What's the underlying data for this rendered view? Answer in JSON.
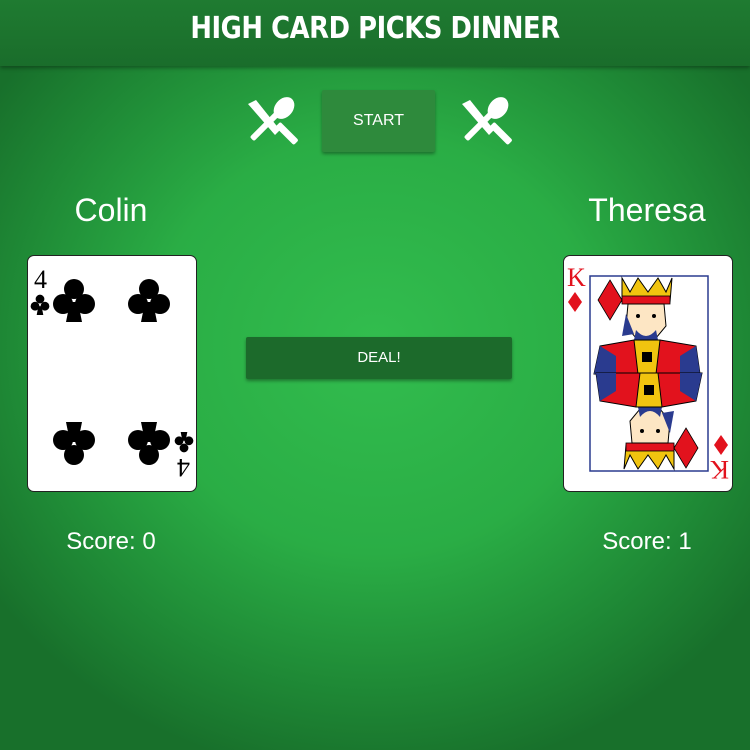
{
  "header": {
    "title": "HIGH CARD PICKS DINNER"
  },
  "controls": {
    "start_label": "START",
    "deal_label": "DEAL!",
    "left_icon": "fork-knife-crossed-icon",
    "right_icon": "fork-knife-crossed-icon"
  },
  "score_prefix": "Score:",
  "players": [
    {
      "name": "Colin",
      "score": "Score: 0",
      "card": {
        "rank": "4",
        "suit": "clubs"
      }
    },
    {
      "name": "Theresa",
      "score": "Score: 1",
      "card": {
        "rank": "K",
        "suit": "diamonds"
      }
    }
  ],
  "colors": {
    "table_green": "#2aad45",
    "header_green": "#1f7b31",
    "start_button": "#2e8a3c",
    "deal_button": "#1c6a2b",
    "diamond_red": "#e2121d"
  }
}
